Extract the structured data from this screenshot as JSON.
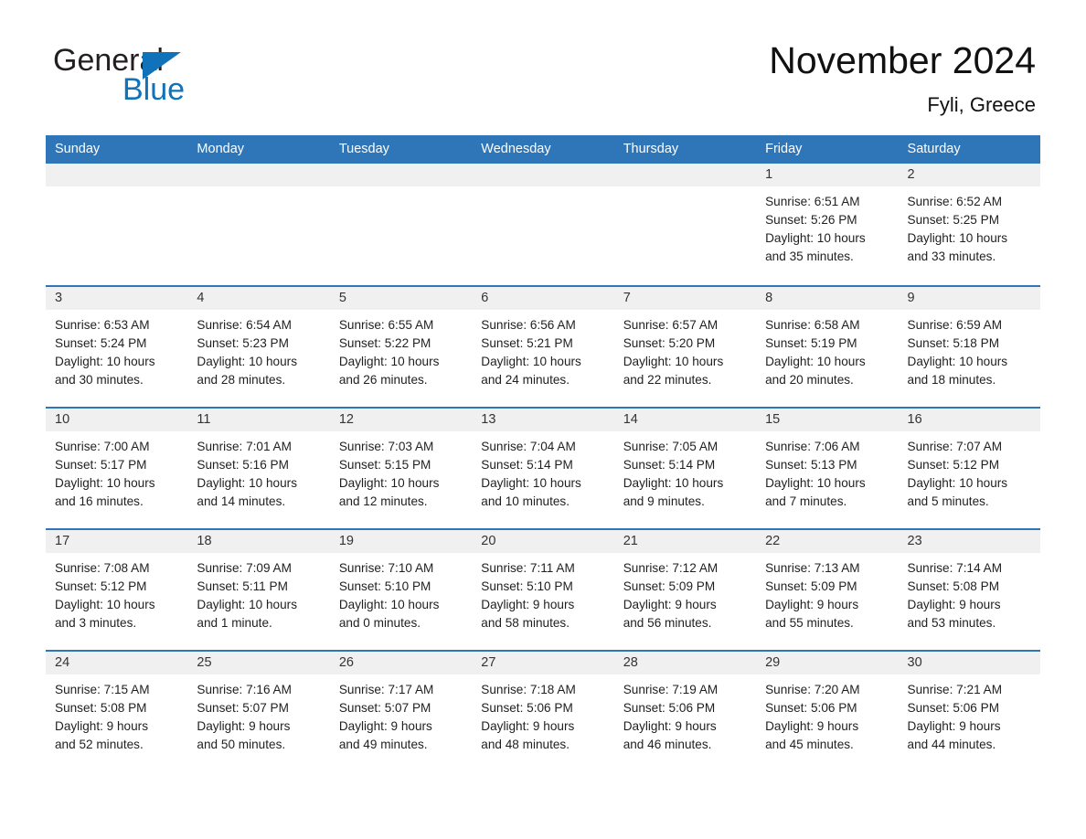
{
  "brand": {
    "name_part1": "General",
    "name_part2": "Blue",
    "triangle_color": "#1072b9",
    "accent_color": "#2f76b8"
  },
  "header": {
    "title": "November 2024",
    "location": "Fyli, Greece"
  },
  "calendar": {
    "weekday_headers": [
      "Sunday",
      "Monday",
      "Tuesday",
      "Wednesday",
      "Thursday",
      "Friday",
      "Saturday"
    ],
    "weeks": [
      [
        {
          "day": "",
          "lines": []
        },
        {
          "day": "",
          "lines": []
        },
        {
          "day": "",
          "lines": []
        },
        {
          "day": "",
          "lines": []
        },
        {
          "day": "",
          "lines": []
        },
        {
          "day": "1",
          "lines": [
            "Sunrise: 6:51 AM",
            "Sunset: 5:26 PM",
            "Daylight: 10 hours",
            "and 35 minutes."
          ]
        },
        {
          "day": "2",
          "lines": [
            "Sunrise: 6:52 AM",
            "Sunset: 5:25 PM",
            "Daylight: 10 hours",
            "and 33 minutes."
          ]
        }
      ],
      [
        {
          "day": "3",
          "lines": [
            "Sunrise: 6:53 AM",
            "Sunset: 5:24 PM",
            "Daylight: 10 hours",
            "and 30 minutes."
          ]
        },
        {
          "day": "4",
          "lines": [
            "Sunrise: 6:54 AM",
            "Sunset: 5:23 PM",
            "Daylight: 10 hours",
            "and 28 minutes."
          ]
        },
        {
          "day": "5",
          "lines": [
            "Sunrise: 6:55 AM",
            "Sunset: 5:22 PM",
            "Daylight: 10 hours",
            "and 26 minutes."
          ]
        },
        {
          "day": "6",
          "lines": [
            "Sunrise: 6:56 AM",
            "Sunset: 5:21 PM",
            "Daylight: 10 hours",
            "and 24 minutes."
          ]
        },
        {
          "day": "7",
          "lines": [
            "Sunrise: 6:57 AM",
            "Sunset: 5:20 PM",
            "Daylight: 10 hours",
            "and 22 minutes."
          ]
        },
        {
          "day": "8",
          "lines": [
            "Sunrise: 6:58 AM",
            "Sunset: 5:19 PM",
            "Daylight: 10 hours",
            "and 20 minutes."
          ]
        },
        {
          "day": "9",
          "lines": [
            "Sunrise: 6:59 AM",
            "Sunset: 5:18 PM",
            "Daylight: 10 hours",
            "and 18 minutes."
          ]
        }
      ],
      [
        {
          "day": "10",
          "lines": [
            "Sunrise: 7:00 AM",
            "Sunset: 5:17 PM",
            "Daylight: 10 hours",
            "and 16 minutes."
          ]
        },
        {
          "day": "11",
          "lines": [
            "Sunrise: 7:01 AM",
            "Sunset: 5:16 PM",
            "Daylight: 10 hours",
            "and 14 minutes."
          ]
        },
        {
          "day": "12",
          "lines": [
            "Sunrise: 7:03 AM",
            "Sunset: 5:15 PM",
            "Daylight: 10 hours",
            "and 12 minutes."
          ]
        },
        {
          "day": "13",
          "lines": [
            "Sunrise: 7:04 AM",
            "Sunset: 5:14 PM",
            "Daylight: 10 hours",
            "and 10 minutes."
          ]
        },
        {
          "day": "14",
          "lines": [
            "Sunrise: 7:05 AM",
            "Sunset: 5:14 PM",
            "Daylight: 10 hours",
            "and 9 minutes."
          ]
        },
        {
          "day": "15",
          "lines": [
            "Sunrise: 7:06 AM",
            "Sunset: 5:13 PM",
            "Daylight: 10 hours",
            "and 7 minutes."
          ]
        },
        {
          "day": "16",
          "lines": [
            "Sunrise: 7:07 AM",
            "Sunset: 5:12 PM",
            "Daylight: 10 hours",
            "and 5 minutes."
          ]
        }
      ],
      [
        {
          "day": "17",
          "lines": [
            "Sunrise: 7:08 AM",
            "Sunset: 5:12 PM",
            "Daylight: 10 hours",
            "and 3 minutes."
          ]
        },
        {
          "day": "18",
          "lines": [
            "Sunrise: 7:09 AM",
            "Sunset: 5:11 PM",
            "Daylight: 10 hours",
            "and 1 minute."
          ]
        },
        {
          "day": "19",
          "lines": [
            "Sunrise: 7:10 AM",
            "Sunset: 5:10 PM",
            "Daylight: 10 hours",
            "and 0 minutes."
          ]
        },
        {
          "day": "20",
          "lines": [
            "Sunrise: 7:11 AM",
            "Sunset: 5:10 PM",
            "Daylight: 9 hours",
            "and 58 minutes."
          ]
        },
        {
          "day": "21",
          "lines": [
            "Sunrise: 7:12 AM",
            "Sunset: 5:09 PM",
            "Daylight: 9 hours",
            "and 56 minutes."
          ]
        },
        {
          "day": "22",
          "lines": [
            "Sunrise: 7:13 AM",
            "Sunset: 5:09 PM",
            "Daylight: 9 hours",
            "and 55 minutes."
          ]
        },
        {
          "day": "23",
          "lines": [
            "Sunrise: 7:14 AM",
            "Sunset: 5:08 PM",
            "Daylight: 9 hours",
            "and 53 minutes."
          ]
        }
      ],
      [
        {
          "day": "24",
          "lines": [
            "Sunrise: 7:15 AM",
            "Sunset: 5:08 PM",
            "Daylight: 9 hours",
            "and 52 minutes."
          ]
        },
        {
          "day": "25",
          "lines": [
            "Sunrise: 7:16 AM",
            "Sunset: 5:07 PM",
            "Daylight: 9 hours",
            "and 50 minutes."
          ]
        },
        {
          "day": "26",
          "lines": [
            "Sunrise: 7:17 AM",
            "Sunset: 5:07 PM",
            "Daylight: 9 hours",
            "and 49 minutes."
          ]
        },
        {
          "day": "27",
          "lines": [
            "Sunrise: 7:18 AM",
            "Sunset: 5:06 PM",
            "Daylight: 9 hours",
            "and 48 minutes."
          ]
        },
        {
          "day": "28",
          "lines": [
            "Sunrise: 7:19 AM",
            "Sunset: 5:06 PM",
            "Daylight: 9 hours",
            "and 46 minutes."
          ]
        },
        {
          "day": "29",
          "lines": [
            "Sunrise: 7:20 AM",
            "Sunset: 5:06 PM",
            "Daylight: 9 hours",
            "and 45 minutes."
          ]
        },
        {
          "day": "30",
          "lines": [
            "Sunrise: 7:21 AM",
            "Sunset: 5:06 PM",
            "Daylight: 9 hours",
            "and 44 minutes."
          ]
        }
      ]
    ]
  }
}
